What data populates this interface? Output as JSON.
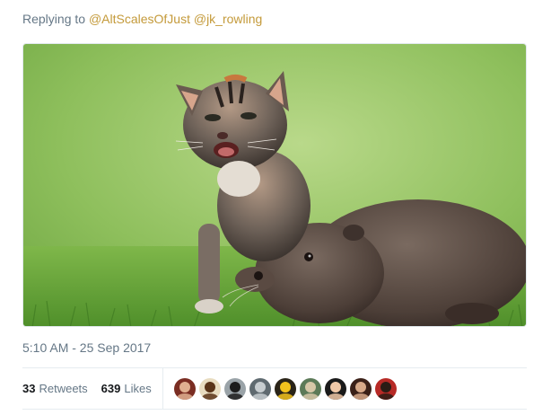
{
  "reply": {
    "prefix": "Replying to",
    "mentions": [
      "@AltScalesOfJust",
      "@jk_rowling"
    ]
  },
  "media": {
    "alt": "",
    "subject": "kitten and otter pup on grass"
  },
  "timestamp": "5:10 AM - 25 Sep 2017",
  "stats": {
    "retweets_count": "33",
    "retweets_label": "Retweets",
    "likes_count": "639",
    "likes_label": "Likes"
  },
  "avatars": [
    {
      "name": "avatar-1",
      "bg": "#7a2d22",
      "fg": "#e0b090"
    },
    {
      "name": "avatar-2",
      "bg": "#e8dcc0",
      "fg": "#5a3418"
    },
    {
      "name": "avatar-3",
      "bg": "#9aa3a8",
      "fg": "#1c1c1c"
    },
    {
      "name": "avatar-4",
      "bg": "#5f6a70",
      "fg": "#c7cdd0"
    },
    {
      "name": "avatar-5",
      "bg": "#2a2418",
      "fg": "#f2c21d"
    },
    {
      "name": "avatar-6",
      "bg": "#5c7a58",
      "fg": "#d6c7a8"
    },
    {
      "name": "avatar-7",
      "bg": "#1a1a1a",
      "fg": "#f1c9a8"
    },
    {
      "name": "avatar-8",
      "bg": "#3a2018",
      "fg": "#d7a989"
    },
    {
      "name": "avatar-9",
      "bg": "#b72a26",
      "fg": "#2b1c15"
    }
  ],
  "colors": {
    "mention": "#c49a3a",
    "muted": "#657786",
    "text": "#14171a",
    "divider": "#e6ecf0"
  }
}
